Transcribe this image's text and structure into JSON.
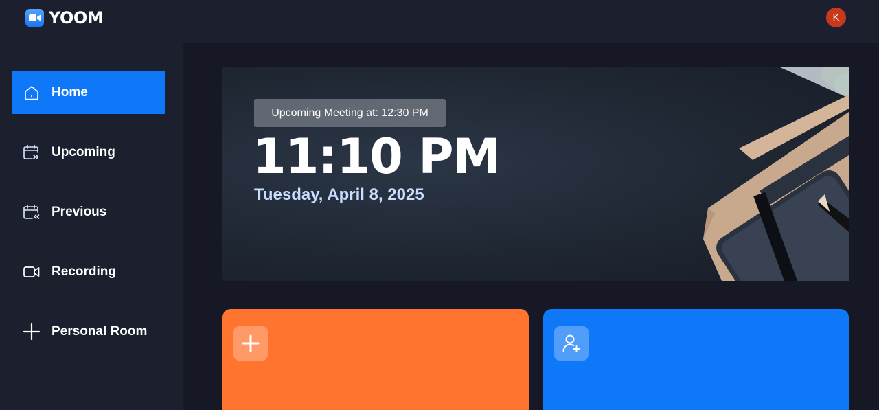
{
  "app": {
    "name": "YOOM",
    "logo_icon": "video-camera-icon",
    "avatar_initial": "K"
  },
  "sidebar": {
    "items": [
      {
        "label": "Home",
        "icon": "home-icon",
        "active": true
      },
      {
        "label": "Upcoming",
        "icon": "calendar-upcoming-icon",
        "active": false
      },
      {
        "label": "Previous",
        "icon": "calendar-previous-icon",
        "active": false
      },
      {
        "label": "Recording",
        "icon": "video-icon",
        "active": false
      },
      {
        "label": "Personal Room",
        "icon": "plus-icon",
        "active": false
      }
    ]
  },
  "hero": {
    "upcoming_meeting": "Upcoming Meeting at: 12:30 PM",
    "time": "11:10 PM",
    "date": "Tuesday, April 8, 2025"
  },
  "cards": [
    {
      "icon": "plus-icon",
      "color": "#ff742e"
    },
    {
      "icon": "add-user-icon",
      "color": "#0e78f9"
    }
  ],
  "colors": {
    "accent_blue": "#0e78f9",
    "accent_orange": "#ff742e",
    "sidebar_bg": "#1c1f2e",
    "page_bg": "#161925",
    "avatar_bg": "#c8381a"
  }
}
